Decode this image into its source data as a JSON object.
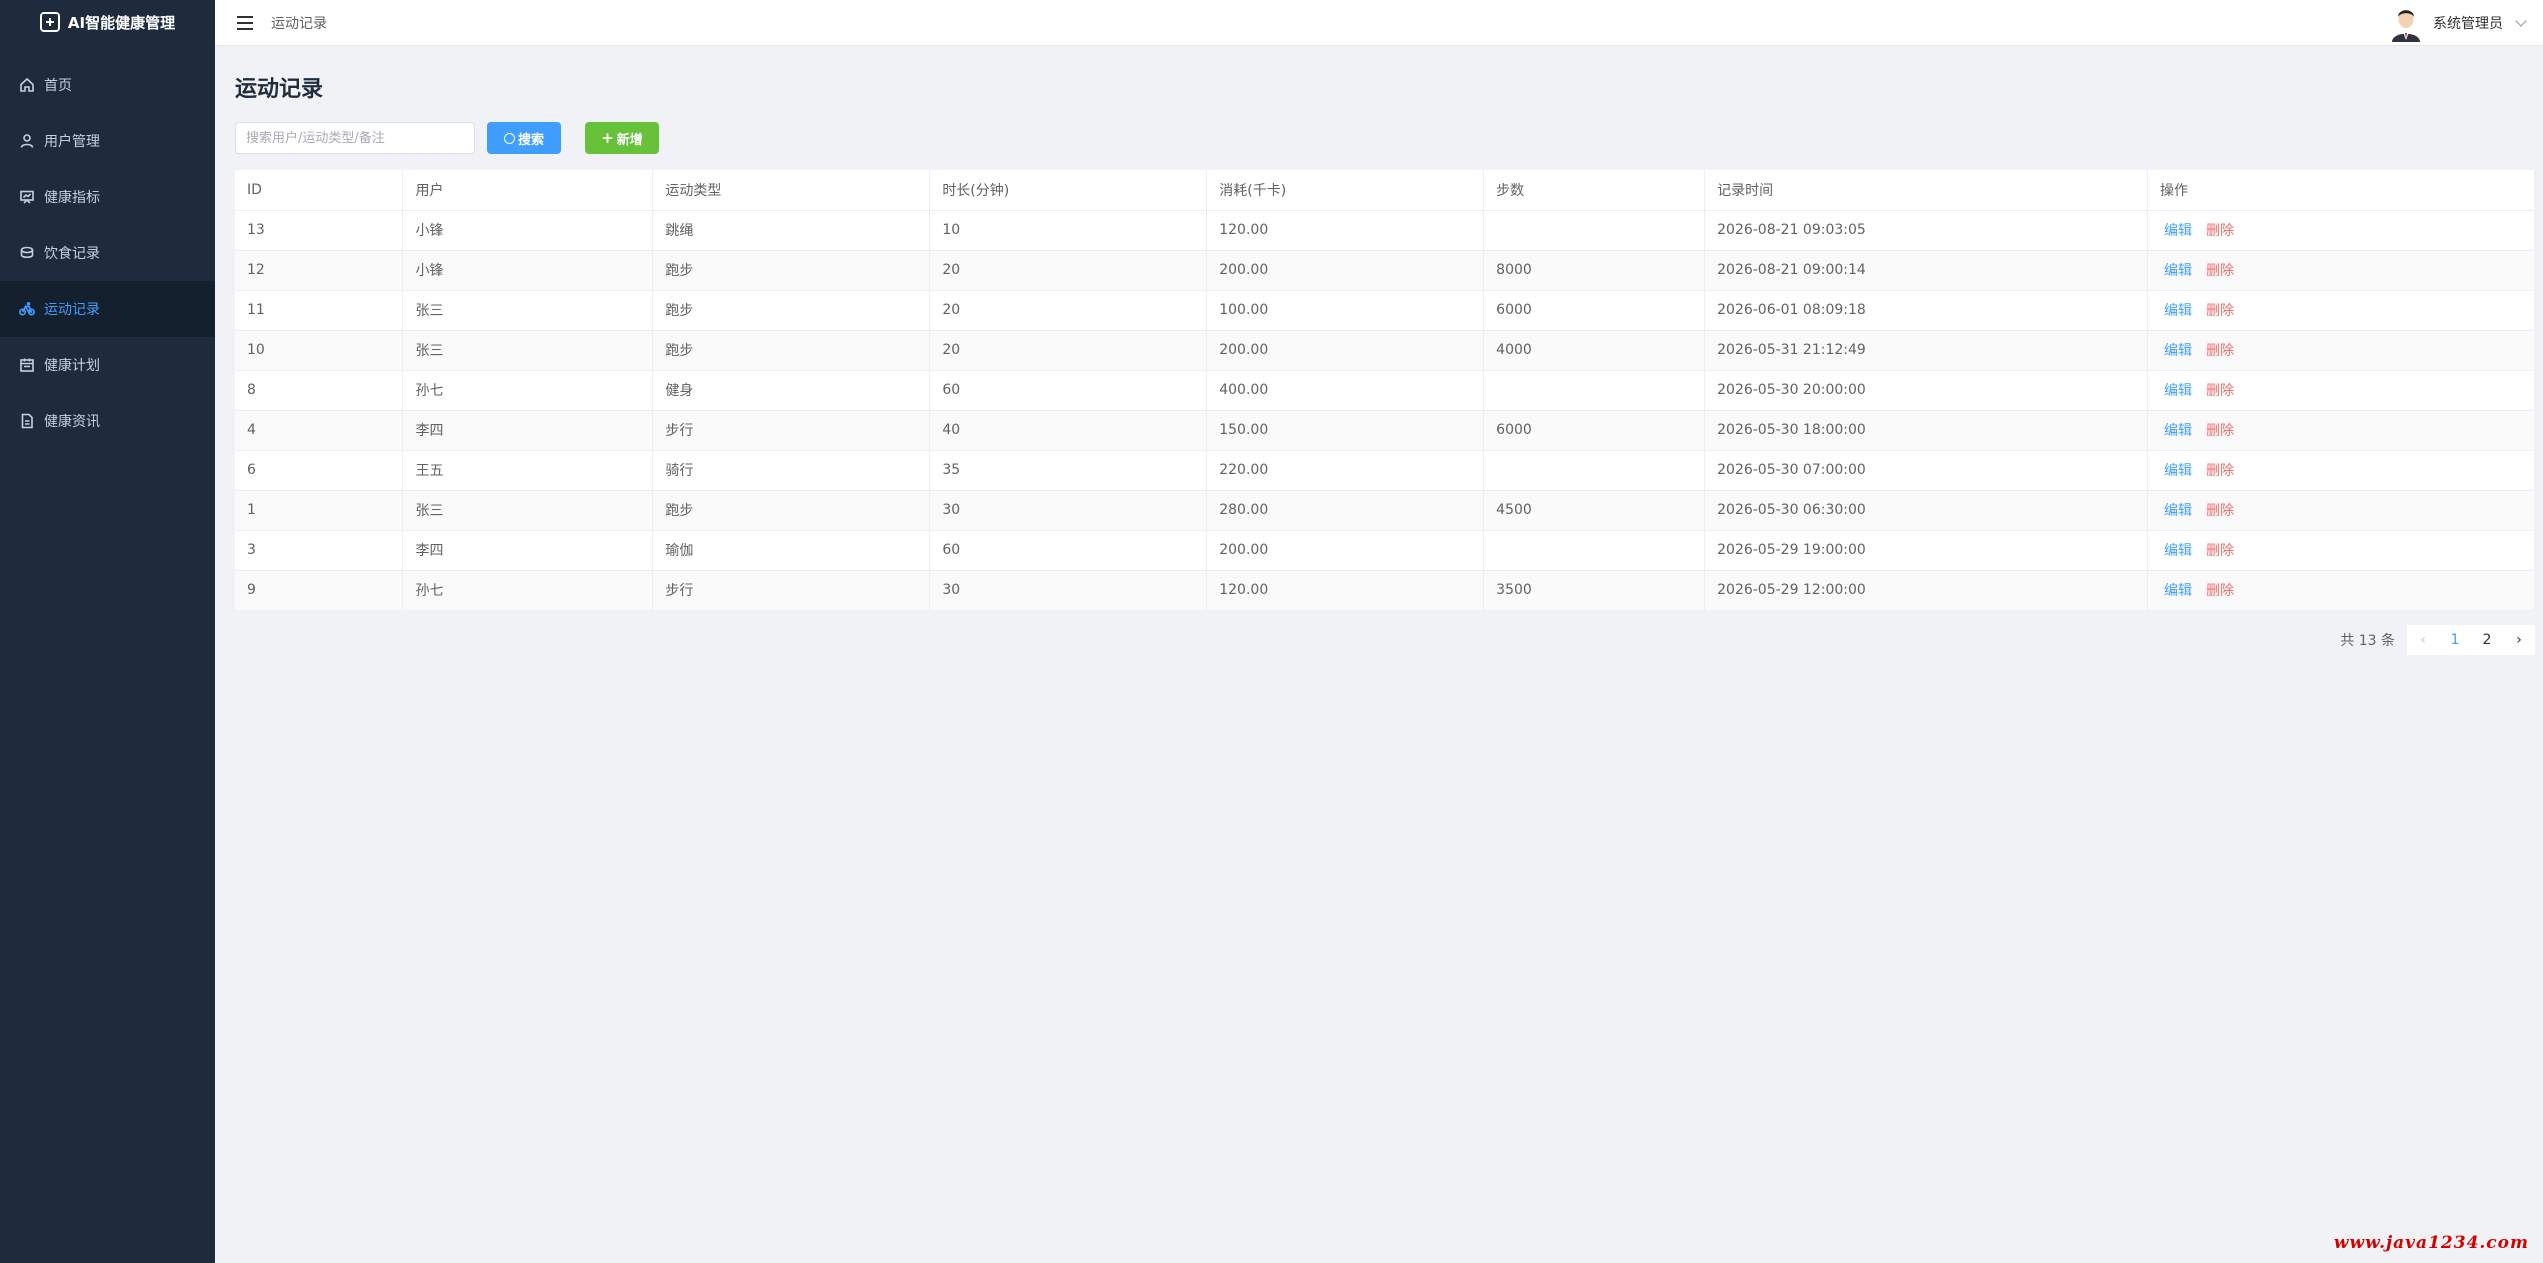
{
  "app": {
    "title": "AI智能健康管理"
  },
  "sidebar": {
    "items": [
      {
        "label": "首页",
        "icon": "home-icon",
        "active": false
      },
      {
        "label": "用户管理",
        "icon": "user-icon",
        "active": false
      },
      {
        "label": "健康指标",
        "icon": "chart-board-icon",
        "active": false
      },
      {
        "label": "饮食记录",
        "icon": "food-bowl-icon",
        "active": false
      },
      {
        "label": "运动记录",
        "icon": "bicycle-icon",
        "active": true
      },
      {
        "label": "健康计划",
        "icon": "calendar-icon",
        "active": false
      },
      {
        "label": "健康资讯",
        "icon": "document-icon",
        "active": false
      }
    ]
  },
  "header": {
    "breadcrumb": "运动记录",
    "username": "系统管理员"
  },
  "main": {
    "title": "运动记录",
    "search": {
      "placeholder": "搜索用户/运动类型/备注",
      "value": "",
      "button": "搜索"
    },
    "add_button": "新增",
    "table": {
      "columns": [
        "ID",
        "用户",
        "运动类型",
        "时长(分钟)",
        "消耗(千卡)",
        "步数",
        "记录时间",
        "操作"
      ],
      "rows": [
        [
          "13",
          "小锋",
          "跳绳",
          "10",
          "120.00",
          "",
          "2026-08-21 09:03:05"
        ],
        [
          "12",
          "小锋",
          "跑步",
          "20",
          "200.00",
          "8000",
          "2026-08-21 09:00:14"
        ],
        [
          "11",
          "张三",
          "跑步",
          "20",
          "100.00",
          "6000",
          "2026-06-01 08:09:18"
        ],
        [
          "10",
          "张三",
          "跑步",
          "20",
          "200.00",
          "4000",
          "2026-05-31 21:12:49"
        ],
        [
          "8",
          "孙七",
          "健身",
          "60",
          "400.00",
          "",
          "2026-05-30 20:00:00"
        ],
        [
          "4",
          "李四",
          "步行",
          "40",
          "150.00",
          "6000",
          "2026-05-30 18:00:00"
        ],
        [
          "6",
          "王五",
          "骑行",
          "35",
          "220.00",
          "",
          "2026-05-30 07:00:00"
        ],
        [
          "1",
          "张三",
          "跑步",
          "30",
          "280.00",
          "4500",
          "2026-05-30 06:30:00"
        ],
        [
          "3",
          "李四",
          "瑜伽",
          "60",
          "200.00",
          "",
          "2026-05-29 19:00:00"
        ],
        [
          "9",
          "孙七",
          "步行",
          "30",
          "120.00",
          "3500",
          "2026-05-29 12:00:00"
        ]
      ],
      "actions": {
        "edit": "编辑",
        "delete": "删除"
      }
    },
    "pagination": {
      "total_text": "共 13 条",
      "pages": [
        "1",
        "2"
      ],
      "current": "1"
    }
  },
  "watermark": "www.java1234.com",
  "colors": {
    "primary": "#409eff",
    "success": "#67c23a",
    "danger": "#f56c6c",
    "sidebar_bg": "#1d2b3d"
  }
}
